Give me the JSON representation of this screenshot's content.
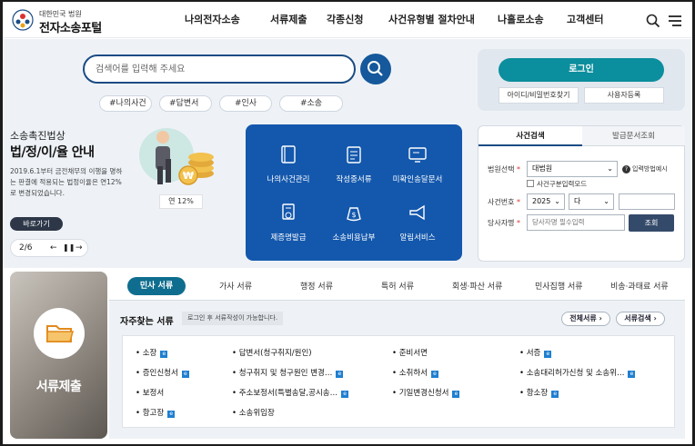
{
  "header": {
    "logo_sub": "대한민국 법원",
    "logo_main": "전자소송포털",
    "nav": [
      "나의전자소송",
      "서류제출",
      "각종신청",
      "사건유형별 절차안내",
      "나홀로소송",
      "고객센터"
    ]
  },
  "search": {
    "placeholder": "검색어를 입력해 주세요",
    "tags": [
      "#나의사건",
      "#답변서",
      "#인사",
      "#소송"
    ]
  },
  "promo": {
    "category": "소송촉진법상",
    "title": "법/정/이/율 안내",
    "desc": "2019.6.1부터 금전채무의 이행을 명하는 판결에 적용되는 법정이율은 연12%로 변경되었습니다.",
    "button": "바로가기",
    "page": "2/6",
    "rate": "연 12%"
  },
  "services": [
    {
      "label": "나의사건관리",
      "icon": "book-icon"
    },
    {
      "label": "작성중서류",
      "icon": "notepad-icon"
    },
    {
      "label": "미확인송달문서",
      "icon": "monitor-icon"
    },
    {
      "label": "제증명발급",
      "icon": "certificate-icon"
    },
    {
      "label": "소송비용납부",
      "icon": "money-bag-icon"
    },
    {
      "label": "알림서비스",
      "icon": "megaphone-icon"
    }
  ],
  "login": {
    "button": "로그인",
    "find": "아이디/비밀번호찾기",
    "register": "사용자등록"
  },
  "case_search": {
    "tab_active": "사건검색",
    "tab_other": "발급문서조회",
    "court_label": "법원선택",
    "court_value": "대법원",
    "help": "입력방법예시",
    "check": "사건구분입력모드",
    "case_label": "사건번호",
    "year": "2025",
    "type": "다",
    "party_label": "당사자명",
    "party_placeholder": "당사자명 필수입력",
    "submit": "조회"
  },
  "documents": {
    "side_title": "서류제출",
    "tabs": [
      "민사 서류",
      "가사 서류",
      "행정 서류",
      "특허 서류",
      "회생·파산 서류",
      "민사집행 서류",
      "비송·과태료 서류"
    ],
    "freq_title": "자주찾는 서류",
    "freq_note": "로그인 후 서류작성이 가능합니다.",
    "all_btn": "전체서류 ›",
    "search_btn": "서류검색 ›",
    "items": [
      "소장",
      "답변서(청구취지/원인)",
      "준비서면",
      "서증",
      "증인신청서",
      "청구취지 및 청구원인 변경…",
      "소취하서",
      "소송대리허가신청 및 소송위…",
      "보정서",
      "주소보정서(특별송달,공시송…",
      "기일변경신청서",
      "항소장",
      "항고장",
      "소송위임장"
    ]
  }
}
